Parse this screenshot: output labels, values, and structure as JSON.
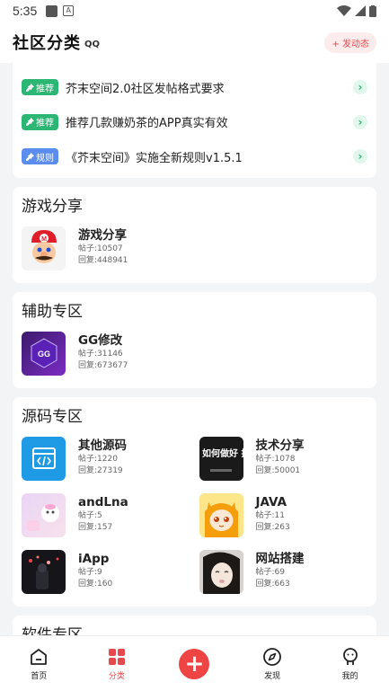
{
  "status_bar": {
    "time": "5:35"
  },
  "header": {
    "title": "社区分类",
    "title_icon": "QQ",
    "post_label": "+ 发动态"
  },
  "notices": [
    {
      "badge": "推荐",
      "badge_color": "#2bb673",
      "icon": "pin-icon",
      "text": "芥末空间2.0社区发帖格式要求"
    },
    {
      "badge": "推荐",
      "badge_color": "#2bb673",
      "icon": "pin-icon",
      "text": "推荐几款赚奶茶的APP真实有效"
    },
    {
      "badge": "规则",
      "badge_color": "#5b8def",
      "icon": "pin-icon",
      "text": "《芥末空间》实施全新规则v1.5.1"
    }
  ],
  "sections": [
    {
      "title": "游戏分享",
      "forums": [
        {
          "name": "游戏分享",
          "posts": "帖子:10507",
          "replies": "回复:448941"
        }
      ]
    },
    {
      "title": "辅助专区",
      "forums": [
        {
          "name": "GG修改",
          "posts": "帖子:31146",
          "replies": "回复:673677",
          "logo_text": "GG"
        }
      ]
    },
    {
      "title": "源码专区",
      "forums": [
        {
          "name": "其他源码",
          "posts": "帖子:1220",
          "replies": "回复:27319"
        },
        {
          "name": "技术分享",
          "posts": "帖子:1078",
          "replies": "回复:50001",
          "logo_text": "如何做好 技术分"
        },
        {
          "name": "andLna",
          "posts": "帖子:5",
          "replies": "回复:157"
        },
        {
          "name": "JAVA",
          "posts": "帖子:11",
          "replies": "回复:263"
        },
        {
          "name": "iApp",
          "posts": "帖子:9",
          "replies": "回复:160"
        },
        {
          "name": "网站搭建",
          "posts": "帖子:69",
          "replies": "回复:663"
        }
      ]
    }
  ],
  "partial_section_title": "软件专区",
  "tabs": [
    {
      "label": "首页",
      "icon": "home-icon"
    },
    {
      "label": "分类",
      "icon": "category-icon",
      "active": true
    },
    {
      "label": "",
      "icon": "plus-icon"
    },
    {
      "label": "发现",
      "icon": "compass-icon"
    },
    {
      "label": "我的",
      "icon": "profile-icon"
    }
  ],
  "colors": {
    "accent": "#e5484d",
    "recommend": "#2bb673",
    "rule": "#5b8def"
  }
}
